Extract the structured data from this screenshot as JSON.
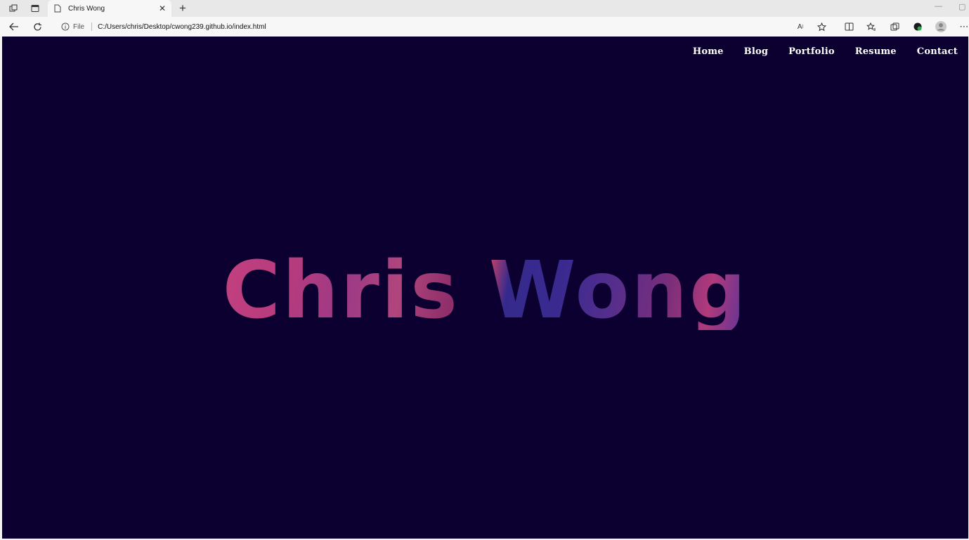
{
  "browser": {
    "tab_title": "Chris Wong",
    "address_scheme": "File",
    "address_url": "C:/Users/chris/Desktop/cwong239.github.io/index.html"
  },
  "site": {
    "nav": [
      "Home",
      "Blog",
      "Portfolio",
      "Resume",
      "Contact"
    ],
    "hero_title": "Chris Wong",
    "background_color": "#0b0030",
    "title_gradient": [
      "#c2407f",
      "#9c3a86",
      "#352a8c",
      "#5a3398"
    ]
  }
}
